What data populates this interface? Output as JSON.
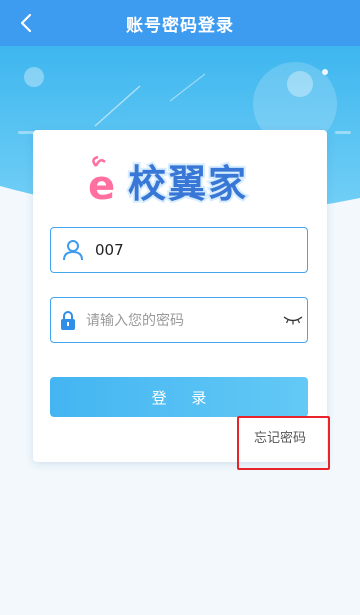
{
  "header": {
    "title": "账号密码登录",
    "back_icon": "chevron-left-icon"
  },
  "logo": {
    "letter": "e",
    "text": "校翼家"
  },
  "form": {
    "account_value": "007",
    "account_icon": "user-icon",
    "password_placeholder": "请输入您的密码",
    "password_icon": "lock-icon",
    "eye_icon": "eye-closed-icon",
    "login_label": "登 录",
    "forgot_label": "忘记密码"
  },
  "colors": {
    "accent": "#3d9bf0",
    "button": "#52bdf3",
    "highlight": "#e8242a"
  }
}
